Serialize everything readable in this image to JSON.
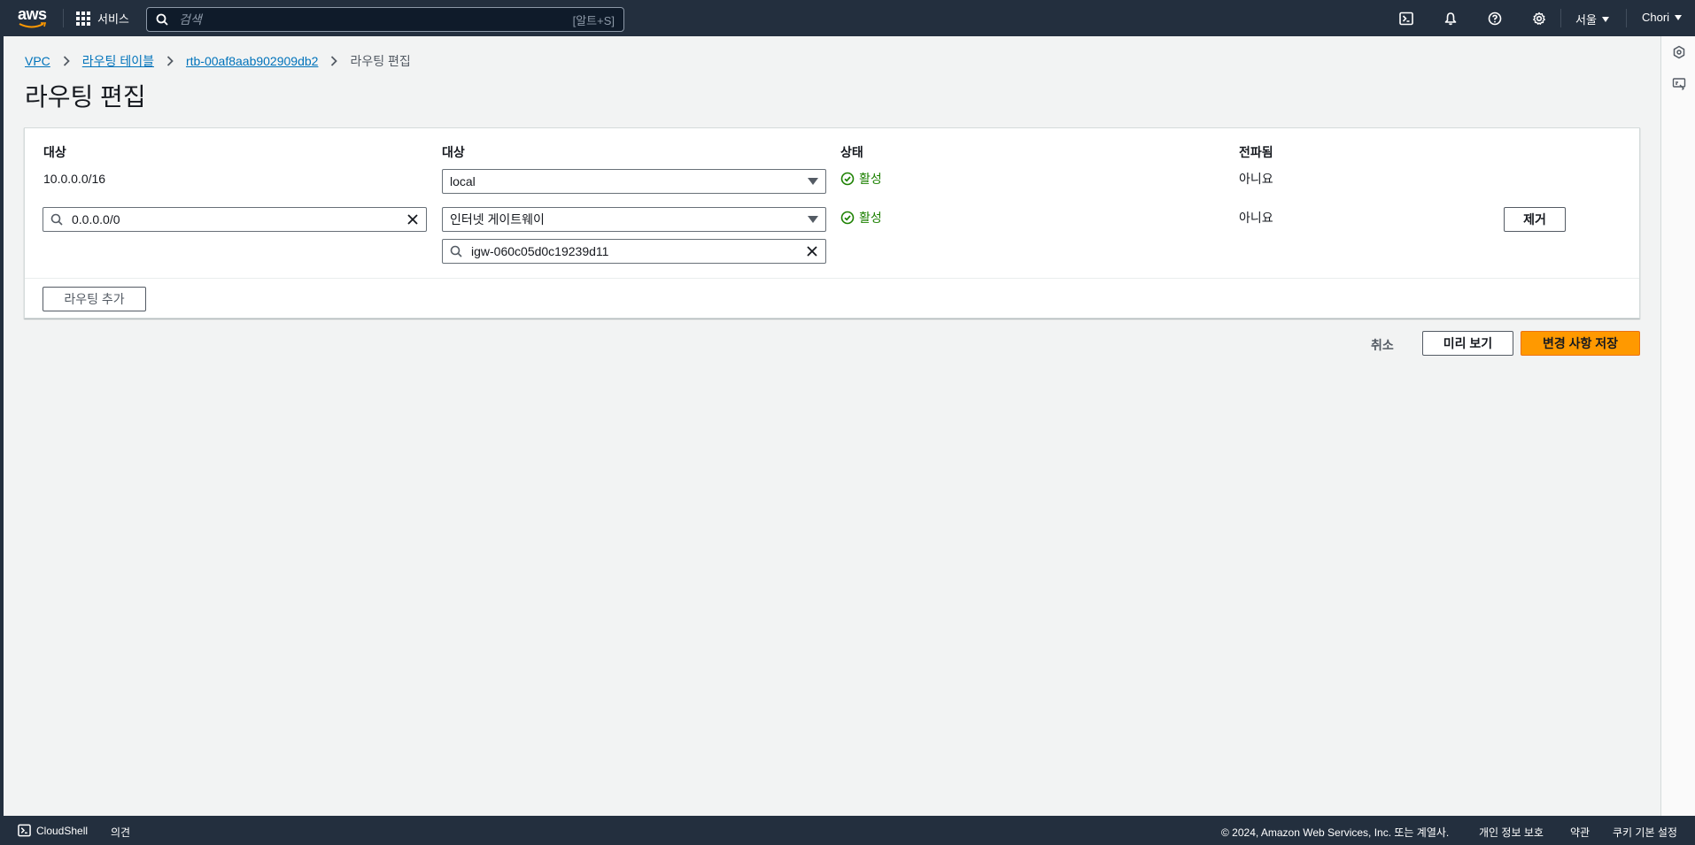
{
  "nav": {
    "logo_text": "aws",
    "services_label": "서비스",
    "search_placeholder": "검색",
    "search_shortcut": "[알트+S]",
    "region_label": "서울",
    "user_label": "Chori"
  },
  "breadcrumb": {
    "items": [
      "VPC",
      "라우팅 테이블",
      "rtb-00af8aab902909db2"
    ],
    "current": "라우팅 편집"
  },
  "page": {
    "title": "라우팅 편집"
  },
  "routes": {
    "headers": {
      "destination": "대상",
      "target": "대상",
      "status": "상태",
      "propagated": "전파됨"
    },
    "rows": [
      {
        "destination": "10.0.0.0/16",
        "target_type": "local",
        "status": "활성",
        "propagated": "아니요"
      },
      {
        "destination": "0.0.0.0/0",
        "target_type": "인터넷 게이트웨이",
        "target_id": "igw-060c05d0c19239d11",
        "status": "활성",
        "propagated": "아니요",
        "remove_label": "제거"
      }
    ],
    "add_route_label": "라우팅 추가"
  },
  "actions": {
    "cancel": "취소",
    "preview": "미리 보기",
    "save": "변경 사항 저장"
  },
  "footer": {
    "cloudshell": "CloudShell",
    "feedback": "의견",
    "copyright": "© 2024, Amazon Web Services, Inc. 또는 계열사.",
    "privacy": "개인 정보 보호",
    "terms": "약관",
    "cookies": "쿠키 기본 설정"
  },
  "colors": {
    "nav_bg": "#232f3e",
    "link": "#0073bb",
    "success": "#1d8102",
    "primary": "#ff9900"
  }
}
